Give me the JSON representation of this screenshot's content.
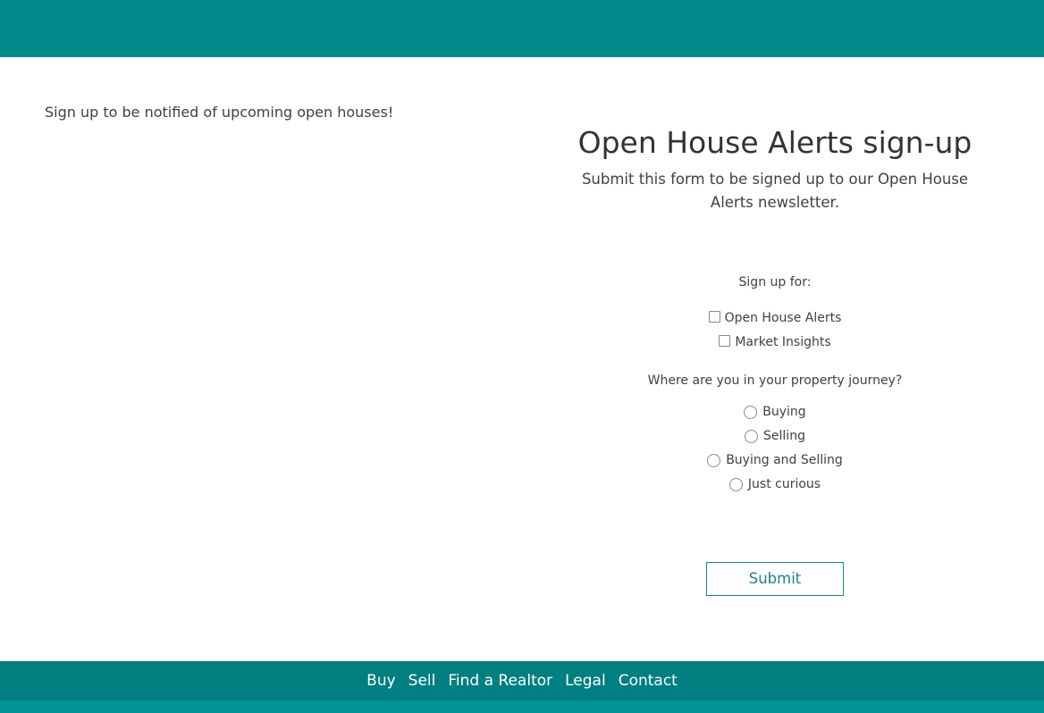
{
  "colors": {
    "header_bg": "#008b8b",
    "footer_bg": "#007f80",
    "footer_strip": "#009494",
    "accent": "#1a8490"
  },
  "intro": {
    "text": "Sign up to be notified of upcoming open houses!"
  },
  "form": {
    "title": "Open House Alerts sign-up",
    "subtitle": "Submit this form to be signed up to our Open House Alerts newsletter.",
    "signup_label": "Sign up for:",
    "signup_options": [
      {
        "label": "Open House Alerts",
        "checked": false
      },
      {
        "label": "Market Insights",
        "checked": false
      }
    ],
    "journey_label": "Where are you in your property journey?",
    "journey_options": [
      {
        "label": "Buying",
        "selected": false
      },
      {
        "label": "Selling",
        "selected": false
      },
      {
        "label": "Buying and Selling",
        "selected": false
      },
      {
        "label": "Just curious",
        "selected": false
      }
    ],
    "submit_label": "Submit"
  },
  "footer": {
    "links": [
      {
        "label": "Buy"
      },
      {
        "label": "Sell"
      },
      {
        "label": "Find a Realtor"
      },
      {
        "label": "Legal"
      },
      {
        "label": "Contact"
      }
    ]
  }
}
